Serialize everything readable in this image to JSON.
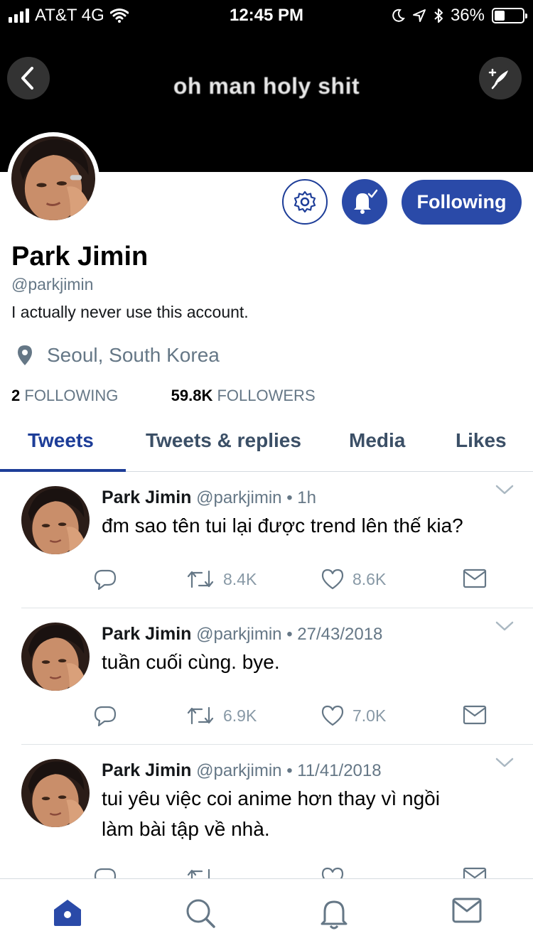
{
  "status_bar": {
    "carrier": "AT&T 4G",
    "time": "12:45 PM",
    "battery": "36%",
    "battery_level": 0.36
  },
  "header": {
    "caption": "oh man holy shit"
  },
  "profile": {
    "name": "Park Jimin",
    "handle": "@parkjimin",
    "bio": "I actually never use this account.",
    "location": "Seoul, South Korea",
    "following_count": "2",
    "following_label": "FOLLOWING",
    "followers_count": "59.8K",
    "followers_label": "FOLLOWERS",
    "follow_button": "Following"
  },
  "tabs": [
    {
      "label": "Tweets"
    },
    {
      "label": "Tweets & replies"
    },
    {
      "label": "Media"
    },
    {
      "label": "Likes"
    }
  ],
  "tweets": [
    {
      "name": "Park Jimin",
      "handle": "@parkjimin",
      "time": "1h",
      "text": "đm sao tên tui lại được trend lên thế kia?",
      "retweets": "8.4K",
      "likes": "8.6K"
    },
    {
      "name": "Park Jimin",
      "handle": "@parkjimin",
      "time": "27/43/2018",
      "text": "tuần cuối cùng. bye.",
      "retweets": "6.9K",
      "likes": "7.0K"
    },
    {
      "name": "Park Jimin",
      "handle": "@parkjimin",
      "time": "11/41/2018",
      "text": "tui yêu việc coi anime hơn thay vì ngồi làm bài tập về nhà.",
      "retweets": "",
      "likes": ""
    }
  ],
  "icons": {
    "back": "chevron-left-icon",
    "compose": "compose-quill-icon",
    "settings": "gear-icon",
    "notifications": "bell-check-icon",
    "location": "location-pin-icon",
    "reply": "reply-icon",
    "retweet": "retweet-icon",
    "like": "heart-icon",
    "dm": "envelope-icon",
    "nav": [
      "home-icon",
      "search-icon",
      "notifications-icon",
      "messages-icon"
    ]
  },
  "colors": {
    "accent": "#2a4aa8",
    "accent_dark": "#1d3d98",
    "secondary_text": "#657786",
    "header_bg": "#000000"
  }
}
